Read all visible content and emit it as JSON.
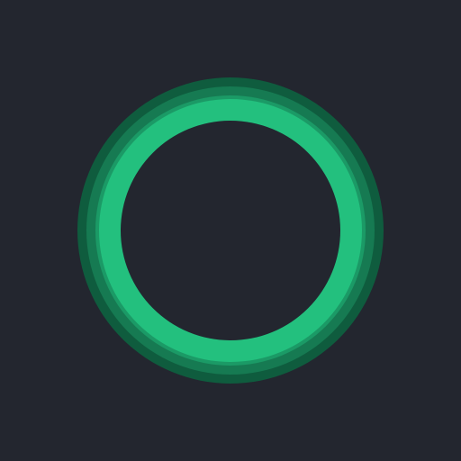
{
  "icon": {
    "name": "ring-icon",
    "colors": {
      "background": "#23262f",
      "ring_outer": "#0f5c3e",
      "ring_middle": "#167a52",
      "ring_mid_inner": "#1b9a66",
      "ring_inner": "#23c07e",
      "center": "#23262f"
    }
  }
}
